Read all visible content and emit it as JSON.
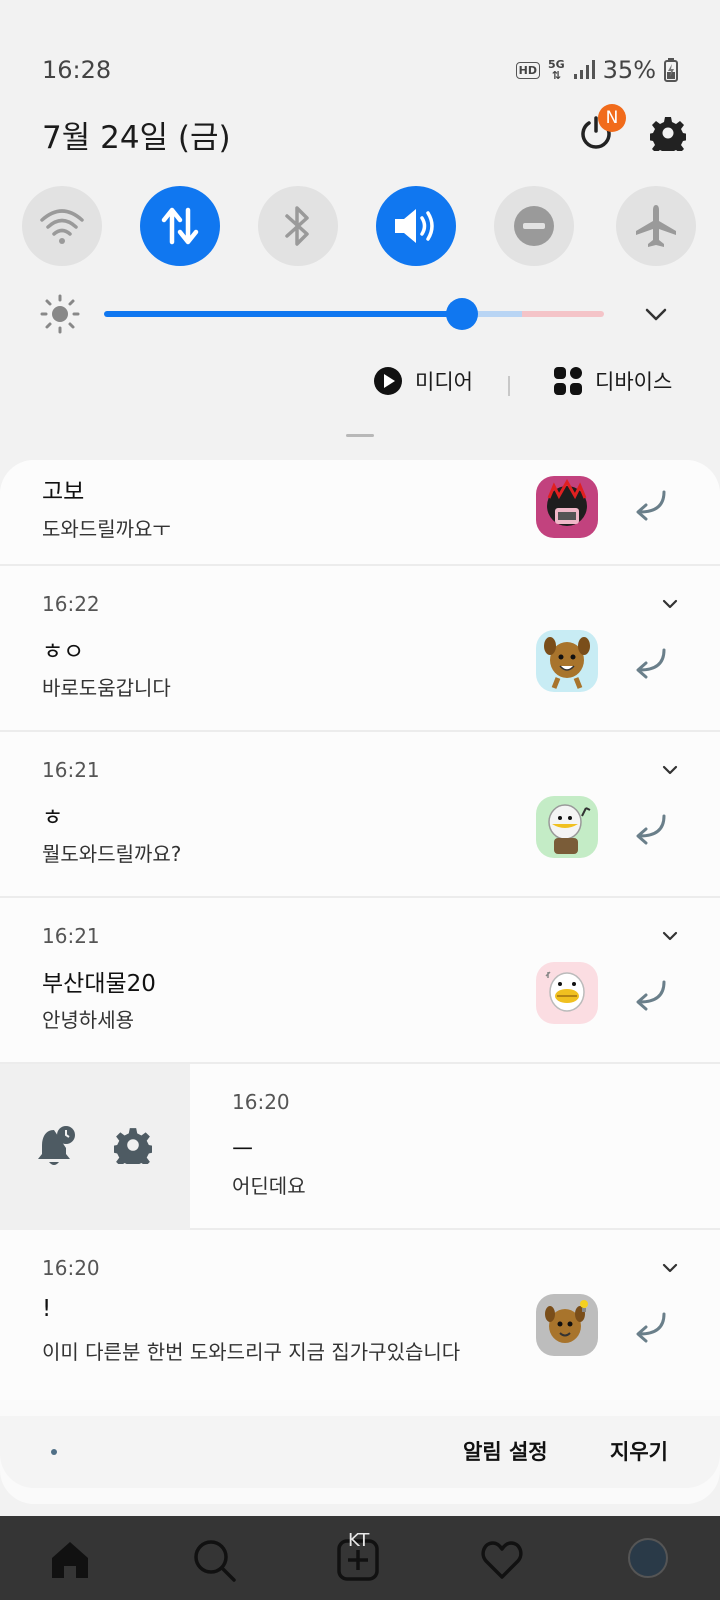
{
  "status_bar": {
    "time": "16:28",
    "hd": "HD",
    "network": "5G",
    "battery": "35%"
  },
  "header": {
    "date": "7월 24일 (금)",
    "power_badge": "N"
  },
  "quick_settings": [
    {
      "icon": "wifi-icon",
      "on": false
    },
    {
      "icon": "mobile-data-icon",
      "on": true
    },
    {
      "icon": "bluetooth-icon",
      "on": false
    },
    {
      "icon": "sound-icon",
      "on": true
    },
    {
      "icon": "do-not-disturb-icon",
      "on": false
    },
    {
      "icon": "airplane-mode-icon",
      "on": false
    }
  ],
  "brightness": {
    "level": 0.72
  },
  "media_row": {
    "media_label": "미디어",
    "devices_label": "디바이스"
  },
  "notifications": [
    {
      "time": "",
      "title": "고보",
      "body": "도와드릴까요ㅜ"
    },
    {
      "time": "16:22",
      "title": "ㅎㅇ",
      "body": "바로도움갑니다"
    },
    {
      "time": "16:21",
      "title": "ㅎ",
      "body": "뭘도와드릴까요?"
    },
    {
      "time": "16:21",
      "title": "부산대물20",
      "body": "안녕하세용"
    },
    {
      "time": "16:20",
      "title": "ㅡ",
      "body": "어딘데요"
    },
    {
      "time": "16:20",
      "title": "!",
      "body": "이미 다른분 한번 도와드리구 지금 집가구있습니다"
    }
  ],
  "bottom_actions": {
    "notification_settings": "알림 설정",
    "clear": "지우기"
  },
  "app_nav": {
    "carrier": "KT"
  },
  "colors": {
    "accent": "#1077f0",
    "badge": "#f16b1b",
    "nav_bg": "#353535"
  }
}
